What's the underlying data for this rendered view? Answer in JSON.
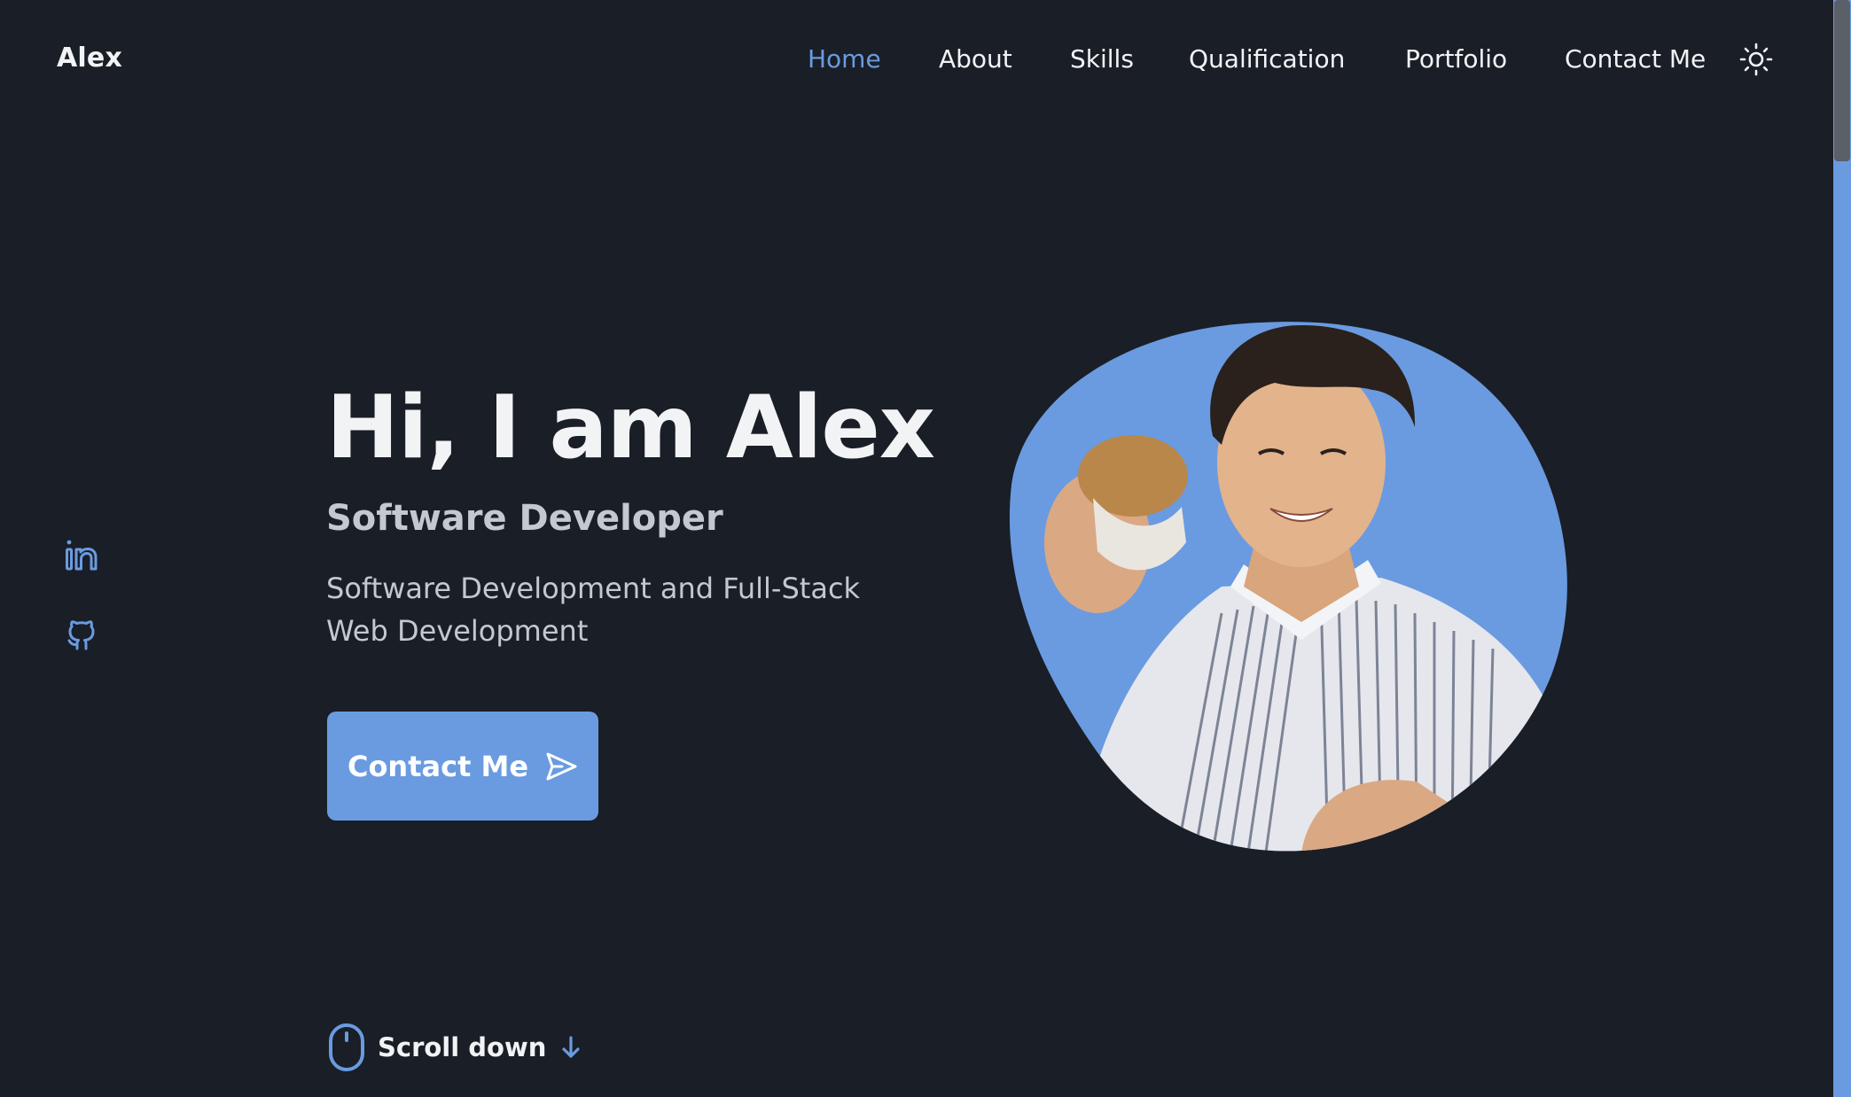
{
  "header": {
    "logo": "Alex",
    "nav": [
      {
        "label": "Home",
        "active": true
      },
      {
        "label": "About",
        "active": false
      },
      {
        "label": "Skills",
        "active": false
      },
      {
        "label": "Qualification",
        "active": false
      },
      {
        "label": "Portfolio",
        "active": false
      },
      {
        "label": "Contact Me",
        "active": false
      }
    ],
    "theme_icon": "sun-icon"
  },
  "social": {
    "items": [
      {
        "icon": "linkedin-icon"
      },
      {
        "icon": "github-icon"
      }
    ]
  },
  "hero": {
    "title": "Hi, I am Alex",
    "subtitle": "Software Developer",
    "description": "Software Development and Full-Stack Web Development",
    "cta_label": "Contact Me",
    "cta_icon": "send-icon"
  },
  "scroll": {
    "label": "Scroll down",
    "mouse_icon": "mouse-icon",
    "arrow_icon": "arrow-down-icon"
  },
  "colors": {
    "background": "#1a1e27",
    "accent": "#6a9be0",
    "text": "#f2f3f5",
    "muted_text": "#c4c8cf"
  }
}
